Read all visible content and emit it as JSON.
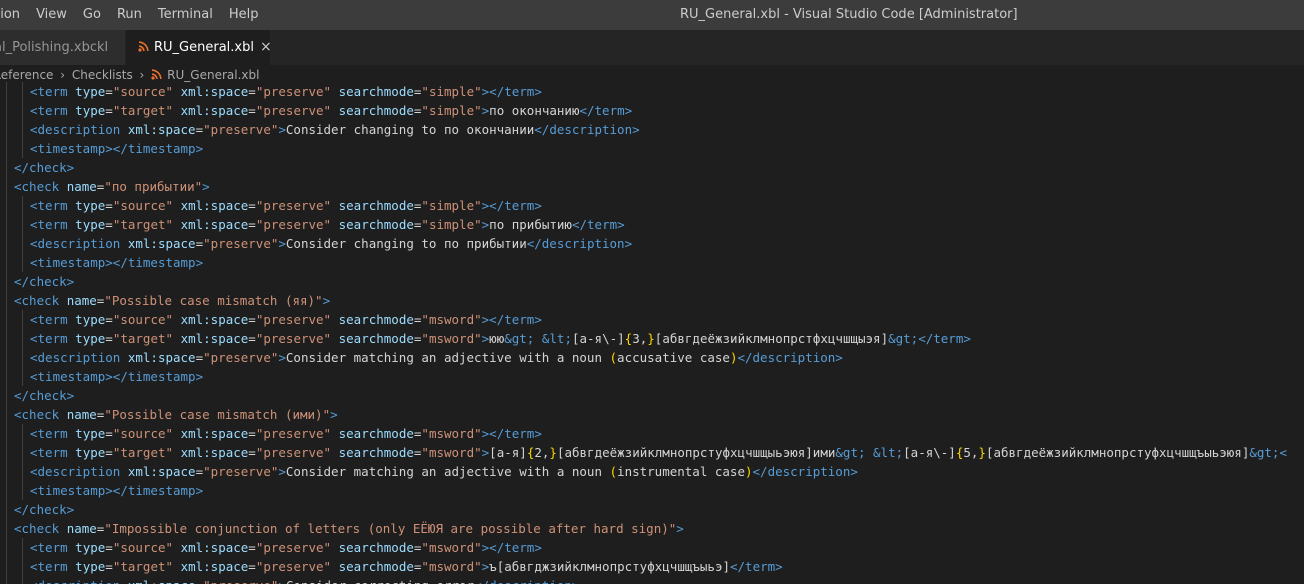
{
  "menu": [
    "ction",
    "View",
    "Go",
    "Run",
    "Terminal",
    "Help"
  ],
  "window_title": "RU_General.xbl - Visual Studio Code [Administrator]",
  "tabs": [
    {
      "label": "al_Polishing.xbckl",
      "active": false
    },
    {
      "label": "RU_General.xbl",
      "active": true,
      "icon": "rss-icon",
      "close": "×"
    }
  ],
  "breadcrumb": [
    "Reference",
    "Checklists",
    "RU_General.xbl"
  ],
  "colors": {
    "tag": "#569cd6",
    "attr": "#9cdcfe",
    "string": "#ce9178",
    "text": "#d4d4d4",
    "bracket": "#ffd700",
    "rss": "#e8702a"
  },
  "code_lines": [
    {
      "indent": 2,
      "parts": [
        [
          "t",
          "<term"
        ],
        [
          "x",
          " "
        ],
        [
          "a",
          "type"
        ],
        [
          "x",
          "="
        ],
        [
          "s",
          "\"source\""
        ],
        [
          "x",
          " "
        ],
        [
          "a",
          "xml:space"
        ],
        [
          "x",
          "="
        ],
        [
          "s",
          "\"preserve\""
        ],
        [
          "x",
          " "
        ],
        [
          "a",
          "searchmode"
        ],
        [
          "x",
          "="
        ],
        [
          "s",
          "\"simple\""
        ],
        [
          "t",
          ">"
        ],
        [
          "t",
          "</term>"
        ]
      ]
    },
    {
      "indent": 2,
      "parts": [
        [
          "t",
          "<term"
        ],
        [
          "x",
          " "
        ],
        [
          "a",
          "type"
        ],
        [
          "x",
          "="
        ],
        [
          "s",
          "\"target\""
        ],
        [
          "x",
          " "
        ],
        [
          "a",
          "xml:space"
        ],
        [
          "x",
          "="
        ],
        [
          "s",
          "\"preserve\""
        ],
        [
          "x",
          " "
        ],
        [
          "a",
          "searchmode"
        ],
        [
          "x",
          "="
        ],
        [
          "s",
          "\"simple\""
        ],
        [
          "t",
          ">"
        ],
        [
          "x",
          "по окончанию"
        ],
        [
          "t",
          "</term>"
        ]
      ]
    },
    {
      "indent": 2,
      "parts": [
        [
          "t",
          "<description"
        ],
        [
          "x",
          " "
        ],
        [
          "a",
          "xml:space"
        ],
        [
          "x",
          "="
        ],
        [
          "s",
          "\"preserve\""
        ],
        [
          "t",
          ">"
        ],
        [
          "x",
          "Consider changing to по окончании"
        ],
        [
          "t",
          "</description>"
        ]
      ]
    },
    {
      "indent": 2,
      "parts": [
        [
          "t",
          "<timestamp>"
        ],
        [
          "t",
          "</timestamp>"
        ]
      ]
    },
    {
      "indent": 1,
      "parts": [
        [
          "t",
          "</check>"
        ]
      ]
    },
    {
      "indent": 1,
      "parts": [
        [
          "t",
          "<check"
        ],
        [
          "x",
          " "
        ],
        [
          "a",
          "name"
        ],
        [
          "x",
          "="
        ],
        [
          "s",
          "\"по прибытии\""
        ],
        [
          "t",
          ">"
        ]
      ]
    },
    {
      "indent": 2,
      "parts": [
        [
          "t",
          "<term"
        ],
        [
          "x",
          " "
        ],
        [
          "a",
          "type"
        ],
        [
          "x",
          "="
        ],
        [
          "s",
          "\"source\""
        ],
        [
          "x",
          " "
        ],
        [
          "a",
          "xml:space"
        ],
        [
          "x",
          "="
        ],
        [
          "s",
          "\"preserve\""
        ],
        [
          "x",
          " "
        ],
        [
          "a",
          "searchmode"
        ],
        [
          "x",
          "="
        ],
        [
          "s",
          "\"simple\""
        ],
        [
          "t",
          ">"
        ],
        [
          "t",
          "</term>"
        ]
      ]
    },
    {
      "indent": 2,
      "parts": [
        [
          "t",
          "<term"
        ],
        [
          "x",
          " "
        ],
        [
          "a",
          "type"
        ],
        [
          "x",
          "="
        ],
        [
          "s",
          "\"target\""
        ],
        [
          "x",
          " "
        ],
        [
          "a",
          "xml:space"
        ],
        [
          "x",
          "="
        ],
        [
          "s",
          "\"preserve\""
        ],
        [
          "x",
          " "
        ],
        [
          "a",
          "searchmode"
        ],
        [
          "x",
          "="
        ],
        [
          "s",
          "\"simple\""
        ],
        [
          "t",
          ">"
        ],
        [
          "x",
          "по прибытию"
        ],
        [
          "t",
          "</term>"
        ]
      ]
    },
    {
      "indent": 2,
      "parts": [
        [
          "t",
          "<description"
        ],
        [
          "x",
          " "
        ],
        [
          "a",
          "xml:space"
        ],
        [
          "x",
          "="
        ],
        [
          "s",
          "\"preserve\""
        ],
        [
          "t",
          ">"
        ],
        [
          "x",
          "Consider changing to по прибытии"
        ],
        [
          "t",
          "</description>"
        ]
      ]
    },
    {
      "indent": 2,
      "parts": [
        [
          "t",
          "<timestamp>"
        ],
        [
          "t",
          "</timestamp>"
        ]
      ]
    },
    {
      "indent": 1,
      "parts": [
        [
          "t",
          "</check>"
        ]
      ]
    },
    {
      "indent": 1,
      "parts": [
        [
          "t",
          "<check"
        ],
        [
          "x",
          " "
        ],
        [
          "a",
          "name"
        ],
        [
          "x",
          "="
        ],
        [
          "s",
          "\"Possible case mismatch (яя)\""
        ],
        [
          "t",
          ">"
        ]
      ]
    },
    {
      "indent": 2,
      "parts": [
        [
          "t",
          "<term"
        ],
        [
          "x",
          " "
        ],
        [
          "a",
          "type"
        ],
        [
          "x",
          "="
        ],
        [
          "s",
          "\"source\""
        ],
        [
          "x",
          " "
        ],
        [
          "a",
          "xml:space"
        ],
        [
          "x",
          "="
        ],
        [
          "s",
          "\"preserve\""
        ],
        [
          "x",
          " "
        ],
        [
          "a",
          "searchmode"
        ],
        [
          "x",
          "="
        ],
        [
          "s",
          "\"msword\""
        ],
        [
          "t",
          ">"
        ],
        [
          "t",
          "</term>"
        ]
      ]
    },
    {
      "indent": 2,
      "parts": [
        [
          "t",
          "<term"
        ],
        [
          "x",
          " "
        ],
        [
          "a",
          "type"
        ],
        [
          "x",
          "="
        ],
        [
          "s",
          "\"target\""
        ],
        [
          "x",
          " "
        ],
        [
          "a",
          "xml:space"
        ],
        [
          "x",
          "="
        ],
        [
          "s",
          "\"preserve\""
        ],
        [
          "x",
          " "
        ],
        [
          "a",
          "searchmode"
        ],
        [
          "x",
          "="
        ],
        [
          "s",
          "\"msword\""
        ],
        [
          "t",
          ">"
        ],
        [
          "x",
          "юю"
        ],
        [
          "e",
          "&gt;"
        ],
        [
          "x",
          " "
        ],
        [
          "e",
          "&lt;"
        ],
        [
          "x",
          "[а-я\\-]"
        ],
        [
          "b",
          "{"
        ],
        [
          "x",
          "3,"
        ],
        [
          "b",
          "}"
        ],
        [
          "x",
          "[абвгдеёжзийклмнопрстфхцчшщыэя]"
        ],
        [
          "e",
          "&gt;"
        ],
        [
          "t",
          "</term>"
        ]
      ]
    },
    {
      "indent": 2,
      "parts": [
        [
          "t",
          "<description"
        ],
        [
          "x",
          " "
        ],
        [
          "a",
          "xml:space"
        ],
        [
          "x",
          "="
        ],
        [
          "s",
          "\"preserve\""
        ],
        [
          "t",
          ">"
        ],
        [
          "x",
          "Consider matching an adjective with a noun "
        ],
        [
          "b",
          "("
        ],
        [
          "x",
          "accusative case"
        ],
        [
          "b",
          ")"
        ],
        [
          "t",
          "</description>"
        ]
      ]
    },
    {
      "indent": 2,
      "parts": [
        [
          "t",
          "<timestamp>"
        ],
        [
          "t",
          "</timestamp>"
        ]
      ]
    },
    {
      "indent": 1,
      "parts": [
        [
          "t",
          "</check>"
        ]
      ]
    },
    {
      "indent": 1,
      "parts": [
        [
          "t",
          "<check"
        ],
        [
          "x",
          " "
        ],
        [
          "a",
          "name"
        ],
        [
          "x",
          "="
        ],
        [
          "s",
          "\"Possible case mismatch (ими)\""
        ],
        [
          "t",
          ">"
        ]
      ]
    },
    {
      "indent": 2,
      "parts": [
        [
          "t",
          "<term"
        ],
        [
          "x",
          " "
        ],
        [
          "a",
          "type"
        ],
        [
          "x",
          "="
        ],
        [
          "s",
          "\"source\""
        ],
        [
          "x",
          " "
        ],
        [
          "a",
          "xml:space"
        ],
        [
          "x",
          "="
        ],
        [
          "s",
          "\"preserve\""
        ],
        [
          "x",
          " "
        ],
        [
          "a",
          "searchmode"
        ],
        [
          "x",
          "="
        ],
        [
          "s",
          "\"msword\""
        ],
        [
          "t",
          ">"
        ],
        [
          "t",
          "</term>"
        ]
      ]
    },
    {
      "indent": 2,
      "parts": [
        [
          "t",
          "<term"
        ],
        [
          "x",
          " "
        ],
        [
          "a",
          "type"
        ],
        [
          "x",
          "="
        ],
        [
          "s",
          "\"target\""
        ],
        [
          "x",
          " "
        ],
        [
          "a",
          "xml:space"
        ],
        [
          "x",
          "="
        ],
        [
          "s",
          "\"preserve\""
        ],
        [
          "x",
          " "
        ],
        [
          "a",
          "searchmode"
        ],
        [
          "x",
          "="
        ],
        [
          "s",
          "\"msword\""
        ],
        [
          "t",
          ">"
        ],
        [
          "x",
          "[а-я]"
        ],
        [
          "b",
          "{"
        ],
        [
          "x",
          "2,"
        ],
        [
          "b",
          "}"
        ],
        [
          "x",
          "[абвгдеёжзийклмнопрстуфхцчшщыьэюя]ими"
        ],
        [
          "e",
          "&gt;"
        ],
        [
          "x",
          " "
        ],
        [
          "e",
          "&lt;"
        ],
        [
          "x",
          "[а-я\\-]"
        ],
        [
          "b",
          "{"
        ],
        [
          "x",
          "5,"
        ],
        [
          "b",
          "}"
        ],
        [
          "x",
          "[абвгдеёжзийклмнопрстуфхцчшщъыьэюя]"
        ],
        [
          "e",
          "&gt;"
        ],
        [
          "t",
          "<"
        ]
      ]
    },
    {
      "indent": 2,
      "parts": [
        [
          "t",
          "<description"
        ],
        [
          "x",
          " "
        ],
        [
          "a",
          "xml:space"
        ],
        [
          "x",
          "="
        ],
        [
          "s",
          "\"preserve\""
        ],
        [
          "t",
          ">"
        ],
        [
          "x",
          "Consider matching an adjective with a noun "
        ],
        [
          "b",
          "("
        ],
        [
          "x",
          "instrumental case"
        ],
        [
          "b",
          ")"
        ],
        [
          "t",
          "</description>"
        ]
      ]
    },
    {
      "indent": 2,
      "parts": [
        [
          "t",
          "<timestamp>"
        ],
        [
          "t",
          "</timestamp>"
        ]
      ]
    },
    {
      "indent": 1,
      "parts": [
        [
          "t",
          "</check>"
        ]
      ]
    },
    {
      "indent": 1,
      "parts": [
        [
          "t",
          "<check"
        ],
        [
          "x",
          " "
        ],
        [
          "a",
          "name"
        ],
        [
          "x",
          "="
        ],
        [
          "s",
          "\"Impossible conjunction of letters (only ЕЁЮЯ are possible after hard sign)\""
        ],
        [
          "t",
          ">"
        ]
      ]
    },
    {
      "indent": 2,
      "parts": [
        [
          "t",
          "<term"
        ],
        [
          "x",
          " "
        ],
        [
          "a",
          "type"
        ],
        [
          "x",
          "="
        ],
        [
          "s",
          "\"source\""
        ],
        [
          "x",
          " "
        ],
        [
          "a",
          "xml:space"
        ],
        [
          "x",
          "="
        ],
        [
          "s",
          "\"preserve\""
        ],
        [
          "x",
          " "
        ],
        [
          "a",
          "searchmode"
        ],
        [
          "x",
          "="
        ],
        [
          "s",
          "\"msword\""
        ],
        [
          "t",
          ">"
        ],
        [
          "t",
          "</term>"
        ]
      ]
    },
    {
      "indent": 2,
      "parts": [
        [
          "t",
          "<term"
        ],
        [
          "x",
          " "
        ],
        [
          "a",
          "type"
        ],
        [
          "x",
          "="
        ],
        [
          "s",
          "\"target\""
        ],
        [
          "x",
          " "
        ],
        [
          "a",
          "xml:space"
        ],
        [
          "x",
          "="
        ],
        [
          "s",
          "\"preserve\""
        ],
        [
          "x",
          " "
        ],
        [
          "a",
          "searchmode"
        ],
        [
          "x",
          "="
        ],
        [
          "s",
          "\"msword\""
        ],
        [
          "t",
          ">"
        ],
        [
          "x",
          "ъ[абвгджзийклмнопрстуфхцчшщъыьэ]"
        ],
        [
          "t",
          "</term>"
        ]
      ]
    },
    {
      "indent": 2,
      "parts": [
        [
          "t",
          "<description"
        ],
        [
          "x",
          " "
        ],
        [
          "a",
          "xml:space"
        ],
        [
          "x",
          "="
        ],
        [
          "s",
          "\"preserve\""
        ],
        [
          "t",
          ">"
        ],
        [
          "x",
          "Consider correcting error"
        ],
        [
          "t",
          "</description>"
        ]
      ]
    }
  ]
}
